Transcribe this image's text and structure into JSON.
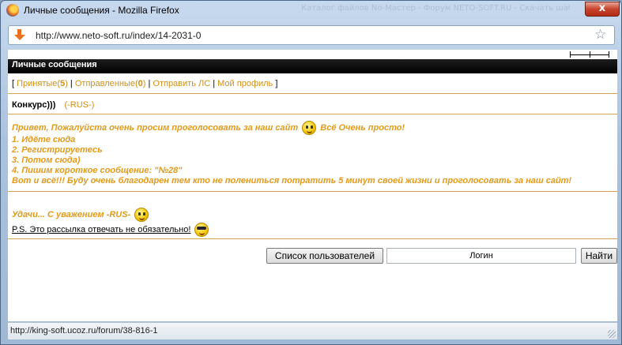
{
  "window": {
    "title": "Личные сообщения - Mozilla Firefox",
    "close_glyph": "x",
    "background_text": "Каталог файлов No-Мастер - Форум NETO-SOFT.RU - Скачать шаблоны для uCoz"
  },
  "address_bar": {
    "url": "http://www.neto-soft.ru/index/14-2031-0"
  },
  "page": {
    "header_title": "Личные сообщения",
    "nav": {
      "open_bracket": "[ ",
      "inbox_label": "Принятые",
      "inbox_count": "5",
      "outbox_label": "Отправленные",
      "outbox_count": "0",
      "send_label": "Отправить ЛС",
      "profile_label": "Мой профиль",
      "separator": " | ",
      "close_bracket": " ]"
    },
    "subject": {
      "title": "Конкурс)))",
      "author": "-RUS-"
    },
    "message": {
      "line1_a": "Привет, Пожалуйста очень просим проголосовать за наш сайт",
      "line1_b": "Всё Очень просто!",
      "step1": "1. Идёте сюда",
      "step2": "2. Регистрируетесь",
      "step3": "3. Потом сюда)",
      "step4": "4. Пишим короткое сообщение: \"№28\"",
      "closing": "Вот и всё!!! Буду очень благодарен тем кто не поленитьcя потратить 5 минут своей жизни и проголосовать за наш сайт!",
      "regards": "Удачи... С уважением -RUS-",
      "ps": "P.S. Это рассылка отвечать не обязательно!"
    },
    "actions": {
      "user_list_button": "Список пользователей",
      "login_placeholder": "Логин",
      "find_button": "Найти"
    }
  },
  "status_bar": {
    "text": "http://king-soft.ucoz.ru/forum/38-816-1"
  },
  "colors": {
    "accent": "#e39a1a",
    "link": "#d48f12",
    "divider": "#d5a550",
    "header_bg": "#000000"
  }
}
